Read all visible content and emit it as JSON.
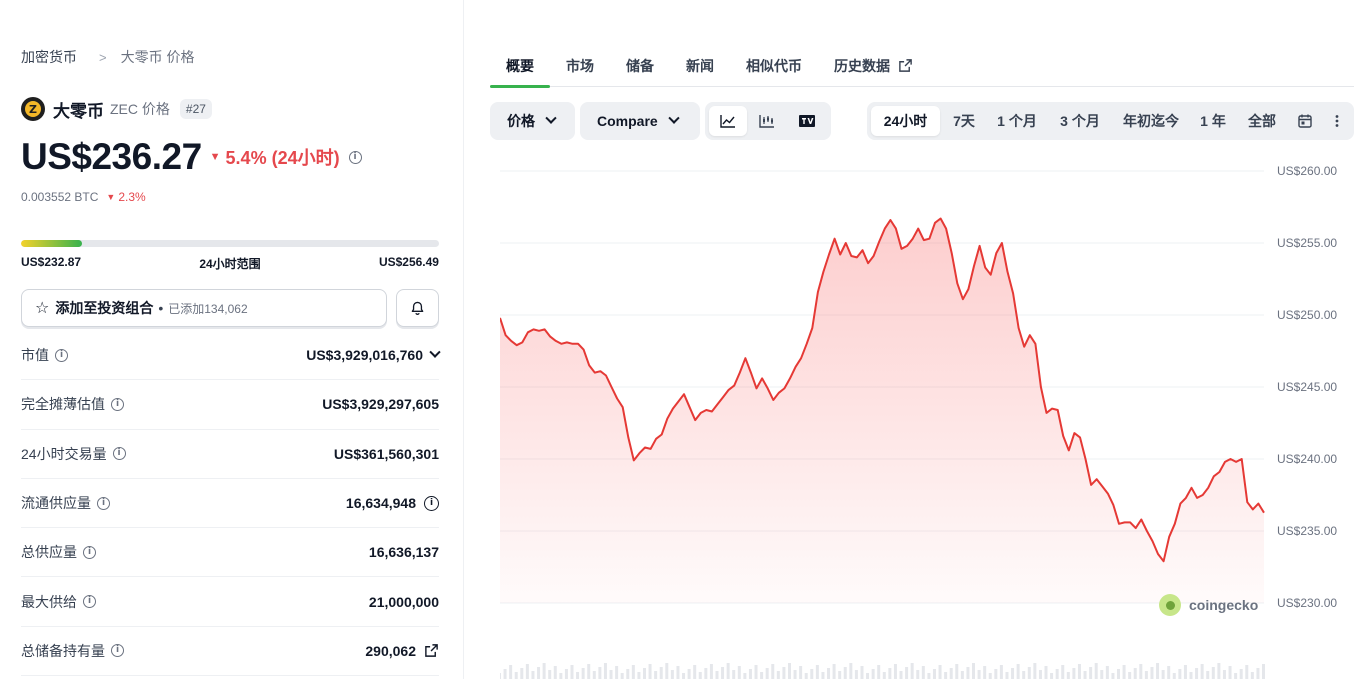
{
  "breadcrumb": {
    "root": "加密货币",
    "current": "大零币 价格"
  },
  "coin": {
    "name": "大零币",
    "symbol_label": "ZEC 价格",
    "rank": "#27"
  },
  "price": {
    "value": "US$236.27",
    "change": "5.4% (24小时)",
    "btc_value": "0.003552 BTC",
    "btc_change": "2.3%"
  },
  "range": {
    "low": "US$232.87",
    "label": "24小时范围",
    "high": "US$256.49",
    "position_fraction": 0.145
  },
  "portfolio": {
    "add_label": "添加至投资组合",
    "added": "已添加134,062"
  },
  "stats": [
    {
      "key": "市值",
      "value": "US$3,929,016,760"
    },
    {
      "key": "完全摊薄估值",
      "value": "US$3,929,297,605"
    },
    {
      "key": "24小时交易量",
      "value": "US$361,560,301"
    },
    {
      "key": "流通供应量",
      "value": "16,634,948"
    },
    {
      "key": "总供应量",
      "value": "16,636,137"
    },
    {
      "key": "最大供给",
      "value": "21,000,000"
    },
    {
      "key": "总储备持有量",
      "value": "290,062"
    }
  ],
  "tabs": [
    "概要",
    "市场",
    "储备",
    "新闻",
    "相似代币",
    "历史数据"
  ],
  "toolbar": {
    "price_label": "价格",
    "compare_label": "Compare",
    "ranges": [
      "24小时",
      "7天",
      "1 个月",
      "3 个月",
      "年初迄今",
      "1 年",
      "全部"
    ],
    "selected_range": "24小时"
  },
  "watermark": "coingecko",
  "colors": {
    "accent": "#37b24d",
    "negative": "#e5484d",
    "line": "#e53935"
  },
  "chart_data": {
    "type": "area",
    "title": "",
    "xlabel": "",
    "ylabel": "",
    "ylim": [
      230,
      260
    ],
    "yticks": [
      "US$260.00",
      "US$255.00",
      "US$250.00",
      "US$245.00",
      "US$240.00",
      "US$235.00",
      "US$230.00"
    ],
    "ytick_values": [
      260,
      255,
      250,
      245,
      240,
      235,
      230
    ],
    "grid": true,
    "series": [
      {
        "values": [
          249.8,
          248.6,
          248.2,
          247.9,
          248.1,
          248.8,
          249.0,
          248.9,
          249.0,
          248.5,
          248.2,
          248.0,
          248.1,
          248.0,
          248.0,
          247.6,
          246.5,
          246.0,
          246.1,
          245.8,
          245.0,
          244.2,
          243.6,
          241.5,
          239.9,
          240.4,
          240.8,
          240.7,
          241.4,
          241.7,
          242.8,
          243.5,
          244.0,
          244.5,
          243.6,
          242.7,
          243.2,
          243.4,
          243.3,
          243.8,
          244.3,
          244.8,
          245.1,
          246.0,
          247.0,
          246.0,
          244.9,
          245.6,
          244.9,
          244.1,
          244.6,
          244.9,
          245.6,
          246.4,
          247.0,
          248.0,
          249.1,
          251.6,
          253.0,
          254.2,
          255.3,
          254.2,
          255.0,
          254.1,
          254.0,
          254.5,
          253.6,
          254.1,
          255.1,
          256.0,
          256.6,
          256.0,
          254.6,
          254.8,
          255.3,
          256.0,
          255.2,
          255.3,
          256.4,
          256.7,
          256.0,
          254.3,
          252.2,
          251.1,
          251.8,
          253.4,
          254.8,
          253.3,
          252.8,
          254.3,
          255.0,
          253.0,
          251.5,
          249.1,
          247.8,
          248.6,
          248.0,
          245.0,
          243.2,
          243.5,
          243.4,
          241.6,
          240.6,
          241.8,
          241.5,
          240.0,
          238.2,
          238.6,
          238.1,
          237.6,
          236.8,
          235.5,
          235.6,
          235.6,
          235.2,
          235.8,
          235.0,
          234.3,
          233.4,
          232.9,
          234.6,
          235.5,
          236.9,
          237.3,
          238.0,
          237.3,
          237.5,
          238.0,
          238.8,
          239.1,
          239.8,
          240.0,
          239.8,
          240.0,
          237.0,
          236.5,
          236.9,
          236.27
        ]
      }
    ]
  }
}
